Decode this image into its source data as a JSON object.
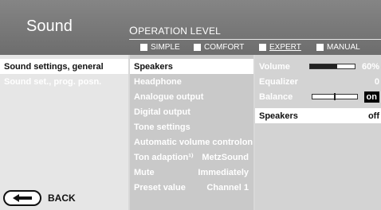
{
  "header": {
    "title": "Sound",
    "operation_level_initial": "O",
    "operation_level_rest": "PERATION LEVEL",
    "modes": [
      {
        "label": "SIMPLE",
        "selected": false
      },
      {
        "label": "COMFORT",
        "selected": false
      },
      {
        "label": "EXPERT",
        "selected": true
      },
      {
        "label": "MANUAL",
        "selected": false
      }
    ]
  },
  "menu_col1": {
    "items": [
      {
        "label": "Sound settings, general",
        "active": true
      },
      {
        "label": "Sound set., prog. posn.",
        "active": false
      }
    ],
    "back_label": "BACK"
  },
  "menu_col2": {
    "items": [
      {
        "label": "Speakers",
        "value": "",
        "selected": true
      },
      {
        "label": "Headphone",
        "value": ""
      },
      {
        "label": "Analogue output",
        "value": ""
      },
      {
        "label": "Digital output",
        "value": ""
      },
      {
        "label": "Tone settings",
        "value": ""
      },
      {
        "label": "Automatic volume control",
        "value": "on"
      },
      {
        "label": "Ton adaption¹⁾",
        "value": "MetzSound"
      },
      {
        "label": "Mute",
        "value": "Immediately"
      },
      {
        "label": "Preset value",
        "value": "Channel 1"
      }
    ]
  },
  "menu_col3": {
    "items": [
      {
        "label": "Volume",
        "value": "60%",
        "slider_level": 0.6
      },
      {
        "label": "Equalizer",
        "value": "0"
      },
      {
        "label": "Balance",
        "value": "on",
        "slider_level": 0.5
      },
      {
        "label": "Speakers",
        "value": "off",
        "selected": true
      }
    ]
  }
}
